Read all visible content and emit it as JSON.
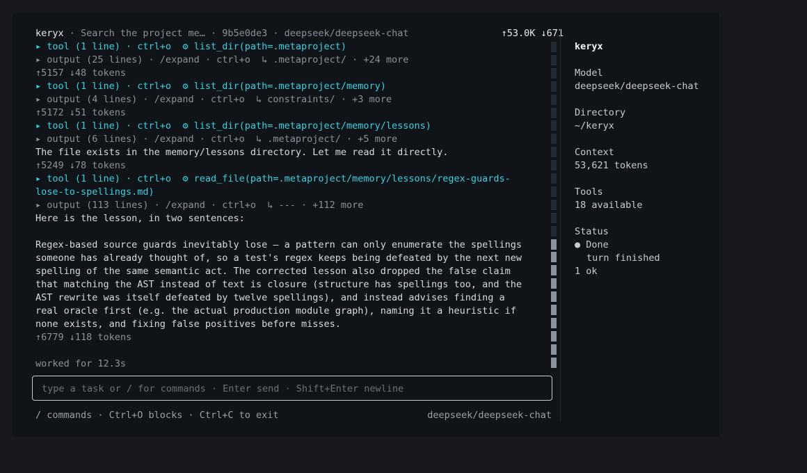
{
  "header": {
    "app": "keryx",
    "session": "Search the project me…",
    "hash": "9b5e0de3",
    "model": "deepseek/deepseek-chat",
    "tokens": "↑53.0K ↓671"
  },
  "transcript": [
    {
      "kind": "tool",
      "text": "▸ tool (1 line) · ctrl+o  ⚙ list_dir(path=.metaproject)"
    },
    {
      "kind": "output",
      "text": "▸ output (25 lines) · /expand · ctrl+o  ↳ .metaproject/ · +24 more"
    },
    {
      "kind": "tokens",
      "text": "↑5157 ↓48 tokens"
    },
    {
      "kind": "tool",
      "text": "▸ tool (1 line) · ctrl+o  ⚙ list_dir(path=.metaproject/memory)"
    },
    {
      "kind": "output",
      "text": "▸ output (4 lines) · /expand · ctrl+o  ↳ constraints/ · +3 more"
    },
    {
      "kind": "tokens",
      "text": "↑5172 ↓51 tokens"
    },
    {
      "kind": "tool",
      "text": "▸ tool (1 line) · ctrl+o  ⚙ list_dir(path=.metaproject/memory/lessons)"
    },
    {
      "kind": "output",
      "text": "▸ output (6 lines) · /expand · ctrl+o  ↳ .metaproject/ · +5 more"
    },
    {
      "kind": "text",
      "text": "The file exists in the memory/lessons directory. Let me read it directly."
    },
    {
      "kind": "tokens",
      "text": "↑5249 ↓78 tokens"
    },
    {
      "kind": "tool",
      "text": "▸ tool (1 line) · ctrl+o  ⚙ read_file(path=.metaproject/memory/lessons/regex-guards-"
    },
    {
      "kind": "tool",
      "text": "lose-to-spellings.md)"
    },
    {
      "kind": "output",
      "text": "▸ output (113 lines) · /expand · ctrl+o  ↳ --- · +112 more"
    },
    {
      "kind": "text",
      "text": "Here is the lesson, in two sentences:"
    },
    {
      "kind": "blank",
      "text": ""
    },
    {
      "kind": "text",
      "text": "Regex-based source guards inevitably lose — a pattern can only enumerate the spellings"
    },
    {
      "kind": "text",
      "text": "someone has already thought of, so a test's regex keeps being defeated by the next new"
    },
    {
      "kind": "text",
      "text": "spelling of the same semantic act. The corrected lesson also dropped the false claim"
    },
    {
      "kind": "text",
      "text": "that matching the AST instead of text is closure (structure has spellings too, and the"
    },
    {
      "kind": "text",
      "text": "AST rewrite was itself defeated by twelve spellings), and instead advises finding a"
    },
    {
      "kind": "text",
      "text": "real oracle first (e.g. the actual production module graph), naming it a heuristic if"
    },
    {
      "kind": "text",
      "text": "none exists, and fixing false positives before misses."
    },
    {
      "kind": "tokens",
      "text": "↑6779 ↓118 tokens"
    },
    {
      "kind": "blank",
      "text": ""
    },
    {
      "kind": "worked",
      "text": "worked for 12.3s"
    }
  ],
  "input": {
    "placeholder": "type a task or / for commands · Enter send · Shift+Enter newline",
    "value": ""
  },
  "footer": {
    "hints": "/ commands · Ctrl+O blocks · Ctrl+C to exit",
    "model": "deepseek/deepseek-chat"
  },
  "sidebar": {
    "title": "keryx",
    "model_label": "Model",
    "model_value": "deepseek/deepseek-chat",
    "directory_label": "Directory",
    "directory_value": "~/keryx",
    "context_label": "Context",
    "context_value": "53,621 tokens",
    "tools_label": "Tools",
    "tools_value": "18 available",
    "status_label": "Status",
    "status_dot": "●",
    "status_value": "Done",
    "status_detail": "turn finished",
    "status_ok": "1 ok"
  },
  "colors": {
    "background": "#17191d",
    "panel": "#101419",
    "tool_accent": "#34d3e1",
    "text": "#d7dbe0",
    "dim": "#8c929a"
  }
}
